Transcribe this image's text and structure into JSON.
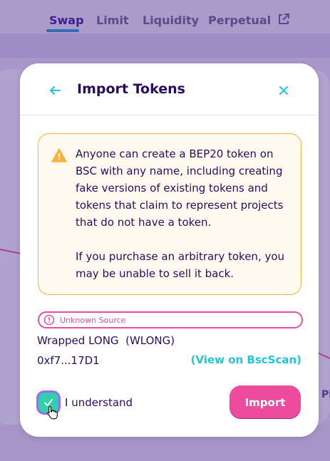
{
  "nav": {
    "tabs": [
      {
        "label": "Swap",
        "active": true
      },
      {
        "label": "Limit",
        "active": false
      },
      {
        "label": "Liquidity",
        "active": false
      },
      {
        "label": "Perpetual",
        "active": false,
        "external": true
      }
    ]
  },
  "background": {
    "right_text": "Pl"
  },
  "modal": {
    "title": "Import Tokens",
    "back_icon": "arrow-left-icon",
    "close_icon": "close-icon",
    "warning": {
      "icon": "warning-icon",
      "paragraph1": "Anyone can create a BEP20 token on BSC with any name, including creating fake versions of existing tokens and tokens that claim to represent projects that do not have a token.",
      "paragraph2": "If you purchase an arbitrary token, you may be unable to sell it back."
    },
    "badge": {
      "icon": "alert-circle-icon",
      "label": "Unknown Source"
    },
    "token": {
      "name": "Wrapped LONG  (WLONG)",
      "address": "0xf7...17D1",
      "explorer_link": "(View on BscScan)"
    },
    "acknowledge": {
      "label": "I understand",
      "checked": true
    },
    "import_label": "Import"
  },
  "colors": {
    "primary_text": "#280d5f",
    "accent_pink": "#ed4b9e",
    "accent_teal": "#1fc7d4",
    "warning": "#ffb237",
    "check_green": "#31d0aa"
  }
}
